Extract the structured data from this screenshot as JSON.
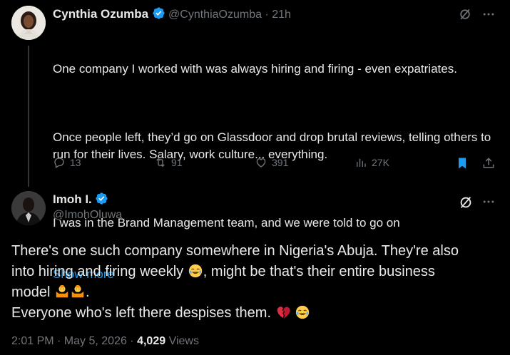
{
  "tweet1": {
    "name": "Cynthia Ozumba",
    "handle": "@CynthiaOzumba",
    "sep": "·",
    "time": "21h",
    "para1": "One company I worked with was always hiring and firing - even expatriates.",
    "para2": "Once people left, they’d go on Glassdoor and drop brutal reviews, telling others to run for their lives. Salary, work culture... everything.",
    "para3": "I was in the Brand Management team, and we were told to go on",
    "show_more": "Show more",
    "replies": "13",
    "reposts": "91",
    "likes": "391",
    "views": "27K"
  },
  "tweet2": {
    "name": "Imoh I.",
    "handle": "@ImohOluwa",
    "line1": "There's one such company somewhere in Nigeria's Abuja. They're also",
    "line2a": "into hiring and firing weekly ",
    "line2b": ", might be that's their entire business",
    "line3a": "model ",
    "line3b": ".",
    "line4": "Everyone who's left there despises them. ",
    "timestamp": "2:01 PM · May 5, 2026 · ",
    "views_count": "4,029",
    "views_label": " Views"
  },
  "icons": {
    "verified": "verified-badge-icon",
    "grok": "grok-icon",
    "more": "more-icon",
    "reply": "reply-icon",
    "repost": "repost-icon",
    "like": "heart-icon",
    "views": "views-icon",
    "bookmark": "bookmark-icon",
    "share": "share-icon",
    "emoji_laugh": "face-with-tears-of-joy-icon",
    "emoji_shrug": "person-shrugging-icon",
    "emoji_broken": "broken-heart-icon"
  },
  "colors": {
    "background": "#000000",
    "text": "#e7e9ea",
    "muted": "#71767b",
    "accent": "#1d9bf0"
  }
}
